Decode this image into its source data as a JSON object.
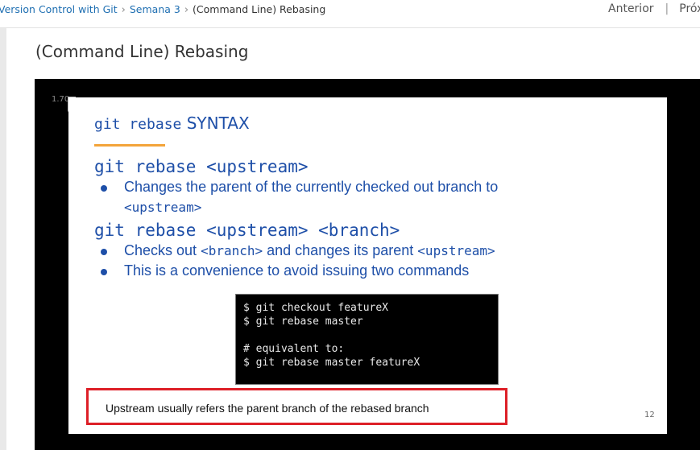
{
  "breadcrumb": {
    "course": "Version Control with Git",
    "week": "Semana 3",
    "current": "(Command Line) Rebasing",
    "separator": "›"
  },
  "nav": {
    "previous": "Anterior",
    "divider": "|",
    "next": "Próx"
  },
  "page_title": "(Command Line) Rebasing",
  "player": {
    "playback_speed": "1.70"
  },
  "slide": {
    "heading_code": "git rebase",
    "heading_text": "SYNTAX",
    "cmd1": "git rebase <upstream>",
    "cmd1_bullet_text": "Changes the parent of the currently checked out branch to",
    "cmd1_bullet_code": "<upstream>",
    "cmd2": "git rebase <upstream> <branch>",
    "cmd2_bullet1_a": "Checks out",
    "cmd2_bullet1_code1": "<branch>",
    "cmd2_bullet1_b": "and changes its parent",
    "cmd2_bullet1_code2": "<upstream>",
    "cmd2_bullet2": "This is a convenience to avoid issuing two commands",
    "terminal_lines": [
      "$ git checkout featureX",
      "$ git rebase master",
      "",
      "# equivalent to:",
      "$ git rebase master featureX"
    ],
    "callout": "Upstream usually refers the parent branch of the rebased branch",
    "page_number": "12"
  },
  "colors": {
    "slide_blue": "#1e4fa8",
    "accent_orange": "#f3a43a",
    "callout_red": "#dd1f27",
    "link_blue": "#1f6fb2"
  }
}
